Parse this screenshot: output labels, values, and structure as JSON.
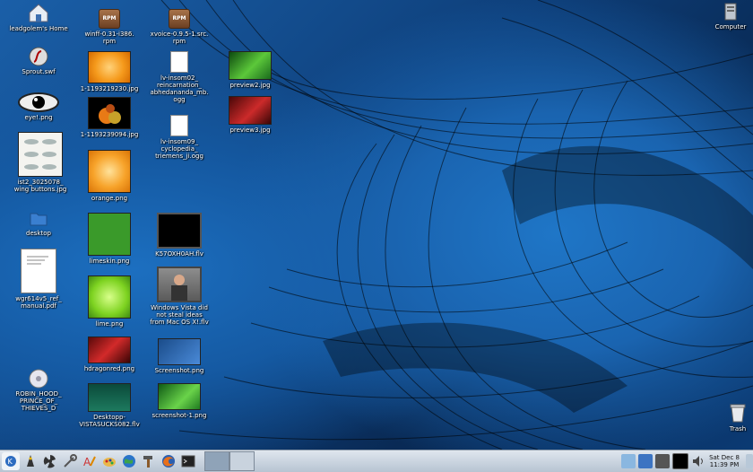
{
  "desktop": {
    "icons": {
      "home": "leadgolem's Home",
      "sprout": "Sprout.swf",
      "eye": "eye!.png",
      "wing": "ist2_3025078_\nwing buttons.jpg",
      "folder": "desktop",
      "manual": "wgr614v5_ref_\nmanual.pdf",
      "dvd": "ROBIN_HOOD_\nPRINCE_OF_\nTHIEVES_D",
      "winff": "winff-0.31-i386.\nrpm",
      "xvoice": "xvoice-0.9.5-1.src.\nrpm",
      "orange1": "1-1193219230.jpg",
      "fruit": "1-1193239094.jpg",
      "orange2": "orange.png",
      "limeskin": "limeskin.png",
      "lime": "lime.png",
      "hdragon": "hdragonred.png",
      "desktopp": "Desktopp-\nVISTASUCKS082.flv",
      "ogg1": "lv-insom02_\nreincarnation_\nabhedananda_mb.\nogg",
      "ogg2": "lv-insom09_\ncyclopedia_\ntriemens_ji.ogg",
      "flv1": "K57OXH0AH.flv",
      "vista": "Windows Vista did\nnot steal ideas\nfrom Mac OS X!.flv",
      "screenshot": "Screenshot.png",
      "screenshot1": "screenshot-1.png",
      "preview2": "preview2.jpg",
      "preview3": "preview3.jpg",
      "computer": "Computer",
      "trash": "Trash"
    }
  },
  "taskbar": {
    "launchers": [
      "kmenu-icon",
      "wizard-icon",
      "fan-icon",
      "tools-icon",
      "text-editor-icon",
      "paint-icon",
      "globe-icon",
      "hammer-icon",
      "firefox-icon",
      "terminal-icon"
    ],
    "clock": {
      "date": "Sat Dec 8",
      "time": "11:39 PM"
    }
  },
  "colors": {
    "wallpaper": "#1a64b0",
    "taskbar": "#c9d3de"
  }
}
